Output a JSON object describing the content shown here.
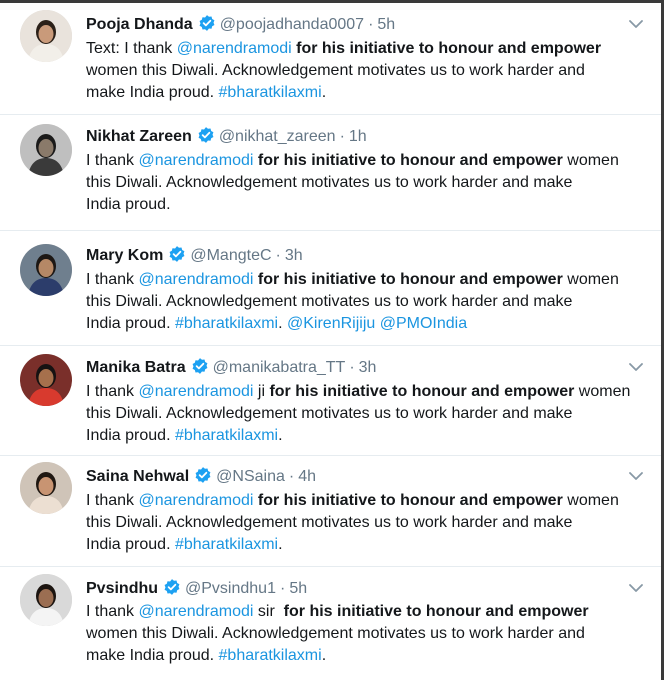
{
  "tweets": [
    {
      "name": "Pooja Dhanda",
      "handle": "@poojadhanda0007",
      "time": "5h",
      "avatar_icon": "user-avatar-pooja",
      "lines": [
        [
          {
            "t": "text",
            "v": "Text: I thank "
          },
          {
            "t": "mention",
            "v": "@narendramodi"
          },
          {
            "t": "strong",
            "v": " for his initiative to honour and empower"
          }
        ],
        [
          {
            "t": "text",
            "v": "women this Diwali. Acknowledgement motivates us to work harder and"
          }
        ],
        [
          {
            "t": "text",
            "v": "make India proud. "
          },
          {
            "t": "hashtag",
            "v": "#bharatkilaxmi"
          },
          {
            "t": "text",
            "v": "."
          }
        ]
      ],
      "has_caret": true
    },
    {
      "name": "Nikhat Zareen",
      "handle": "@nikhat_zareen",
      "time": "1h",
      "avatar_icon": "user-avatar-nikhat",
      "lines": [
        [
          {
            "t": "text",
            "v": "I thank "
          },
          {
            "t": "mention",
            "v": "@narendramodi"
          },
          {
            "t": "strong",
            "v": " for his initiative to honour and empower"
          },
          {
            "t": "text",
            "v": " women"
          }
        ],
        [
          {
            "t": "text",
            "v": "this Diwali. Acknowledgement motivates us to work harder and make"
          }
        ],
        [
          {
            "t": "text",
            "v": "India proud."
          }
        ]
      ],
      "has_caret": false
    },
    {
      "name": "Mary Kom",
      "handle": "@MangteC",
      "time": "3h",
      "avatar_icon": "user-avatar-mary",
      "lines": [
        [
          {
            "t": "text",
            "v": "I thank "
          },
          {
            "t": "mention",
            "v": "@narendramodi"
          },
          {
            "t": "strong",
            "v": " for his initiative to honour and empower"
          },
          {
            "t": "text",
            "v": " women"
          }
        ],
        [
          {
            "t": "text",
            "v": "this Diwali. Acknowledgement motivates us to work harder and make"
          }
        ],
        [
          {
            "t": "text",
            "v": "India proud. "
          },
          {
            "t": "hashtag",
            "v": "#bharatkilaxmi"
          },
          {
            "t": "text",
            "v": ". "
          },
          {
            "t": "mention",
            "v": "@KirenRijiju"
          },
          {
            "t": "text",
            "v": " "
          },
          {
            "t": "mention",
            "v": "@PMOIndia"
          }
        ]
      ],
      "has_caret": false
    },
    {
      "name": "Manika Batra",
      "handle": "@manikabatra_TT",
      "time": "3h",
      "avatar_icon": "user-avatar-manika",
      "lines": [
        [
          {
            "t": "text",
            "v": "I thank "
          },
          {
            "t": "mention",
            "v": "@narendramodi"
          },
          {
            "t": "text",
            "v": " ji "
          },
          {
            "t": "strong",
            "v": "for his initiative to honour and empower"
          },
          {
            "t": "text",
            "v": " women"
          }
        ],
        [
          {
            "t": "text",
            "v": "this Diwali. Acknowledgement motivates us to work harder and make"
          }
        ],
        [
          {
            "t": "text",
            "v": "India proud. "
          },
          {
            "t": "hashtag",
            "v": "#bharatkilaxmi"
          },
          {
            "t": "text",
            "v": "."
          }
        ]
      ],
      "has_caret": true
    },
    {
      "name": "Saina Nehwal",
      "handle": "@NSaina",
      "time": "4h",
      "avatar_icon": "user-avatar-saina",
      "lines": [
        [
          {
            "t": "text",
            "v": "I thank "
          },
          {
            "t": "mention",
            "v": "@narendramodi"
          },
          {
            "t": "strong",
            "v": " for his initiative to honour and empower"
          },
          {
            "t": "text",
            "v": " women"
          }
        ],
        [
          {
            "t": "text",
            "v": "this Diwali. Acknowledgement motivates us to work harder and make"
          }
        ],
        [
          {
            "t": "text",
            "v": "India proud. "
          },
          {
            "t": "hashtag",
            "v": "#bharatkilaxmi"
          },
          {
            "t": "text",
            "v": "."
          }
        ]
      ],
      "has_caret": true
    },
    {
      "name": "Pvsindhu",
      "handle": "@Pvsindhu1",
      "time": "5h",
      "avatar_icon": "user-avatar-pvsindhu",
      "lines": [
        [
          {
            "t": "text",
            "v": "I thank "
          },
          {
            "t": "mention",
            "v": "@narendramodi"
          },
          {
            "t": "text",
            "v": " sir  "
          },
          {
            "t": "strong",
            "v": "for his initiative to honour and empower"
          }
        ],
        [
          {
            "t": "text",
            "v": "women this Diwali. Acknowledgement motivates us to work harder and"
          }
        ],
        [
          {
            "t": "text",
            "v": "make India proud. "
          },
          {
            "t": "hashtag",
            "v": "#bharatkilaxmi"
          },
          {
            "t": "text",
            "v": "."
          }
        ]
      ],
      "has_caret": true
    }
  ],
  "colors": {
    "link": "#1b95e0",
    "verified": "#1da1f2",
    "muted": "#657786",
    "text": "#14171a"
  }
}
